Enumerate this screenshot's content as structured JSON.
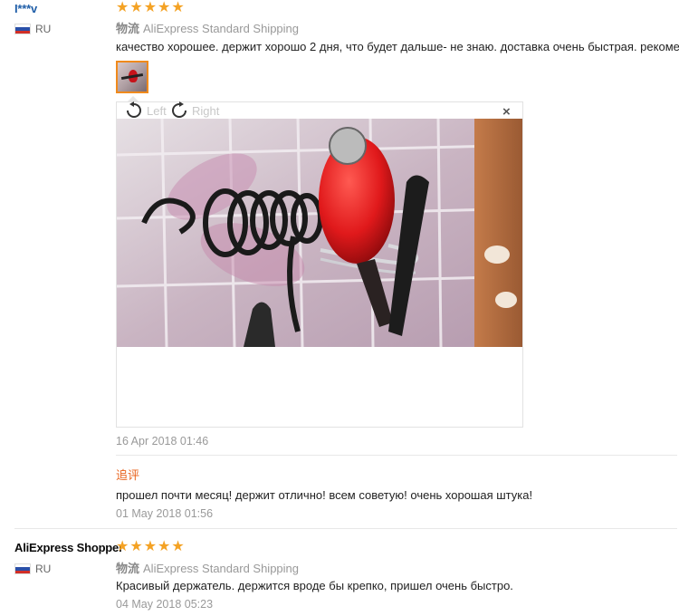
{
  "reviews": [
    {
      "user": "I***v",
      "rating": 5,
      "country": "RU",
      "shipping_label": "物流",
      "shipping": "AliExpress Standard Shipping",
      "text": "качество хорошее. держит хорошо 2 дня, что будет дальше- не знаю. доставка очень быстрая. рекомендую",
      "date": "16 Apr 2018 01:46",
      "followup_label": "追评",
      "followup_text": "прошел почти месяц! держит отлично! всем советую! очень хорошая штука!",
      "followup_date": "01 May 2018 01:56"
    },
    {
      "user": "AliExpress Shopper",
      "rating": 5,
      "country": "RU",
      "shipping_label": "物流",
      "shipping": "AliExpress Standard Shipping",
      "text": "Красивый держатель. держится вроде бы крепко, пришел очень быстро.",
      "date": "04 May 2018 05:23"
    }
  ],
  "viewer": {
    "rotate_left": "Left",
    "rotate_right": "Right",
    "close_symbol": "×"
  },
  "colors": {
    "star": "#f4a224",
    "user_link": "#1f5ea8",
    "followup": "#e8631c",
    "thumb_border": "#f08a1c"
  },
  "icons": [
    "star-icon",
    "rotate-left-icon",
    "rotate-right-icon",
    "close-icon",
    "russia-flag-icon"
  ]
}
